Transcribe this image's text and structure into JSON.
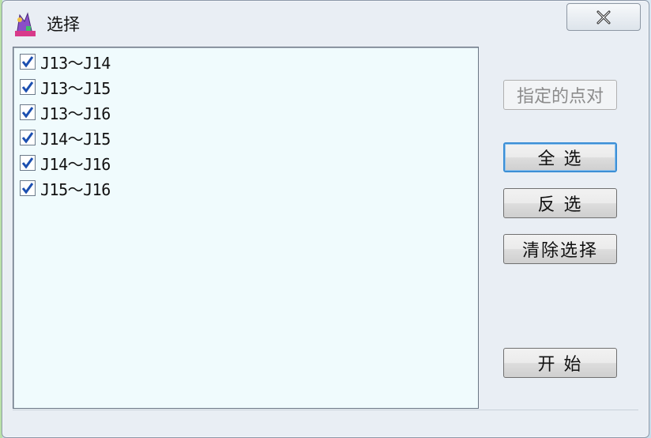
{
  "window": {
    "title": "选择"
  },
  "list": {
    "items": [
      {
        "label": "J13～J14",
        "checked": true
      },
      {
        "label": "J13～J15",
        "checked": true
      },
      {
        "label": "J13～J16",
        "checked": true
      },
      {
        "label": "J14～J15",
        "checked": true
      },
      {
        "label": "J14～J16",
        "checked": true
      },
      {
        "label": "J15～J16",
        "checked": true
      }
    ]
  },
  "buttons": {
    "specified_pairs": "指定的点对",
    "select_all": "全 选",
    "invert": "反 选",
    "clear": "清除选择",
    "start": "开 始"
  },
  "colors": {
    "list_bg": "#f0fbfd",
    "check_blue": "#1c4fb0",
    "default_button_border": "#3c8fd6"
  }
}
